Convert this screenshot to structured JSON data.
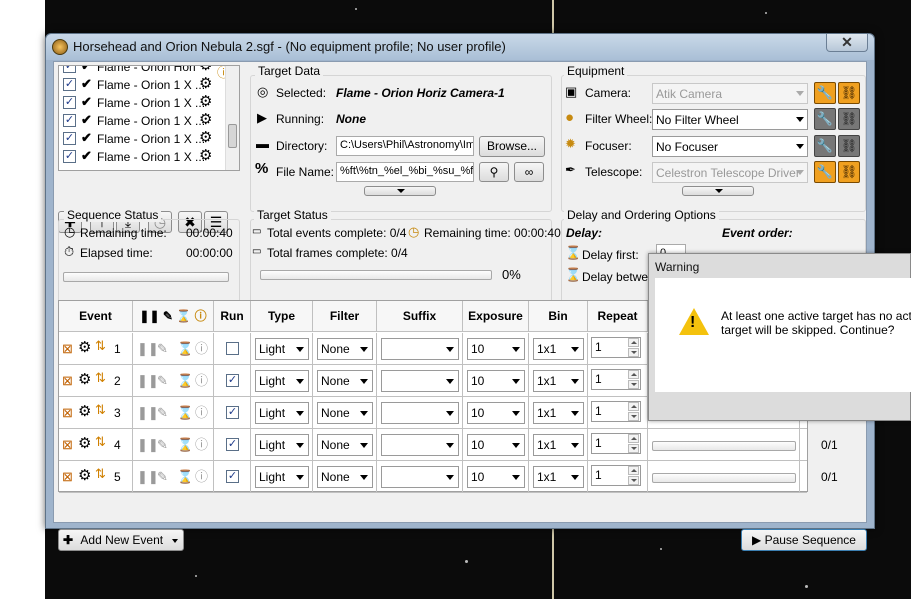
{
  "window": {
    "title": "Horsehead and Orion Nebula 2.sgf - (No equipment profile; No user profile)",
    "close_glyph": "✕"
  },
  "target_list": {
    "items": [
      {
        "label": "Flame - Orion Hori",
        "checked": true
      },
      {
        "label": "Flame - Orion 1 X ...",
        "checked": true
      },
      {
        "label": "Flame - Orion 1 X ...",
        "checked": true
      },
      {
        "label": "Flame - Orion 1 X ...",
        "checked": true
      },
      {
        "label": "Flame - Orion 1 X ...",
        "checked": true
      },
      {
        "label": "Flame - Orion 1 X ...",
        "checked": true
      }
    ]
  },
  "target_data": {
    "group_label": "Target Data",
    "selected_label": "Selected:",
    "selected_value": "Flame - Orion Horiz Camera-1",
    "running_label": "Running:",
    "running_value": "None",
    "directory_label": "Directory:",
    "directory_value": "C:\\Users\\Phil\\Astronomy\\Ima",
    "browse_label": "Browse...",
    "filename_label": "File Name:",
    "filename_value": "%ft\\%tn_%el_%bi_%su_%fn"
  },
  "equipment": {
    "group_label": "Equipment",
    "camera_label": "Camera:",
    "camera_value": "Atik Camera",
    "filter_label": "Filter Wheel:",
    "filter_value": "No Filter Wheel",
    "focuser_label": "Focuser:",
    "focuser_value": "No Focuser",
    "telescope_label": "Telescope:",
    "telescope_value": "Celestron Telescope Driver"
  },
  "sequence_status": {
    "group_label": "Sequence Status",
    "remaining_label": "Remaining time:",
    "remaining_value": "00:00:40",
    "elapsed_label": "Elapsed time:",
    "elapsed_value": "00:00:00",
    "progress": 0
  },
  "target_status": {
    "group_label": "Target Status",
    "events_label": "Total events complete: 0/4",
    "remaining_label": "Remaining time: 00:00:40",
    "frames_label": "Total frames complete: 0/4",
    "percent": "0%",
    "progress": 0
  },
  "delay": {
    "group_label": "Delay and Ordering Options",
    "delay_heading": "Delay:",
    "delay_first_label": "Delay first:",
    "delay_first_value": "0",
    "delay_between_label": "Delay between",
    "event_order_heading": "Event order:"
  },
  "grid": {
    "headers": {
      "event": "Event",
      "run": "Run",
      "type": "Type",
      "filter": "Filter",
      "suffix": "Suffix",
      "exposure": "Exposure",
      "bin": "Bin",
      "repeat": "Repeat"
    },
    "rows": [
      {
        "num": "1",
        "run": false,
        "type": "Light",
        "filter": "None",
        "suffix": "",
        "exposure": "10",
        "bin": "1x1",
        "repeat": "1",
        "progress_text": ""
      },
      {
        "num": "2",
        "run": true,
        "type": "Light",
        "filter": "None",
        "suffix": "",
        "exposure": "10",
        "bin": "1x1",
        "repeat": "1",
        "progress_text": ""
      },
      {
        "num": "3",
        "run": true,
        "type": "Light",
        "filter": "None",
        "suffix": "",
        "exposure": "10",
        "bin": "1x1",
        "repeat": "1",
        "progress_text": ""
      },
      {
        "num": "4",
        "run": true,
        "type": "Light",
        "filter": "None",
        "suffix": "",
        "exposure": "10",
        "bin": "1x1",
        "repeat": "1",
        "progress_text": "0/1"
      },
      {
        "num": "5",
        "run": true,
        "type": "Light",
        "filter": "None",
        "suffix": "",
        "exposure": "10",
        "bin": "1x1",
        "repeat": "1",
        "progress_text": "0/1"
      }
    ]
  },
  "footer": {
    "add_event_label": "Add New Event",
    "pause_label": "Pause Sequence"
  },
  "warning": {
    "title": "Warning",
    "line1": "At least one active target has no acti",
    "line2": "target will be skipped.  Continue?"
  },
  "colors": {
    "accent_orange": "#f0a020",
    "window_frame": "#9fb4cc",
    "warning_yellow": "#f4c20d"
  }
}
